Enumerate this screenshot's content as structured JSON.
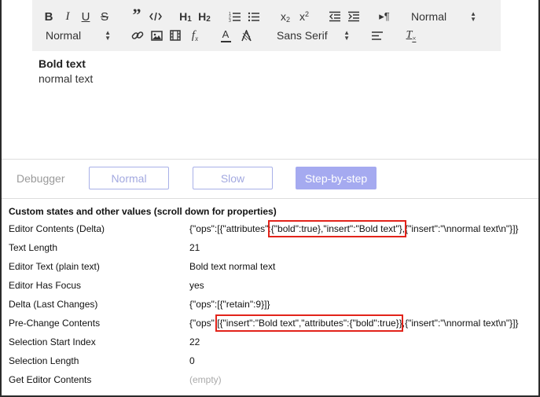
{
  "toolbar": {
    "header_select_value": "Normal",
    "size_select_value": "Normal",
    "font_select_value": "Sans Serif",
    "subscript_label": "x",
    "superscript_label": "x",
    "h1_label": "H",
    "h2_label": "H"
  },
  "editor": {
    "bold_line": "Bold text",
    "normal_line": "normal text"
  },
  "debugger": {
    "label": "Debugger",
    "buttons": [
      {
        "label": "Normal",
        "active": false
      },
      {
        "label": "Slow",
        "active": false
      },
      {
        "label": "Step-by-step",
        "active": true
      }
    ]
  },
  "properties": {
    "title": "Custom states and other values (scroll down for properties)",
    "rows": [
      {
        "key": "Editor Contents (Delta)",
        "value": "{\"ops\":[{\"attributes\":{\"bold\":true},\"insert\":\"Bold text\"},{\"insert\":\"\\nnormal text\\n\"}]}"
      },
      {
        "key": "Text Length",
        "value": "21"
      },
      {
        "key": "Editor Text (plain text)",
        "value": "Bold text normal text"
      },
      {
        "key": "Editor Has Focus",
        "value": "yes"
      },
      {
        "key": "Delta (Last Changes)",
        "value": "{\"ops\":[{\"retain\":9}]}"
      },
      {
        "key": "Pre-Change Contents",
        "value": "{\"ops\":[{\"insert\":\"Bold text\",\"attributes\":{\"bold\":true}},{\"insert\":\"\\nnormal text\\n\"}]}"
      },
      {
        "key": "Selection Start Index",
        "value": "22"
      },
      {
        "key": "Selection Length",
        "value": "0"
      },
      {
        "key": "Get Editor Contents",
        "value": "(empty)"
      }
    ]
  },
  "colors": {
    "accent": "#a5aaf0",
    "highlight": "#e2231a",
    "toolbar_bg": "#f0f0f0"
  }
}
